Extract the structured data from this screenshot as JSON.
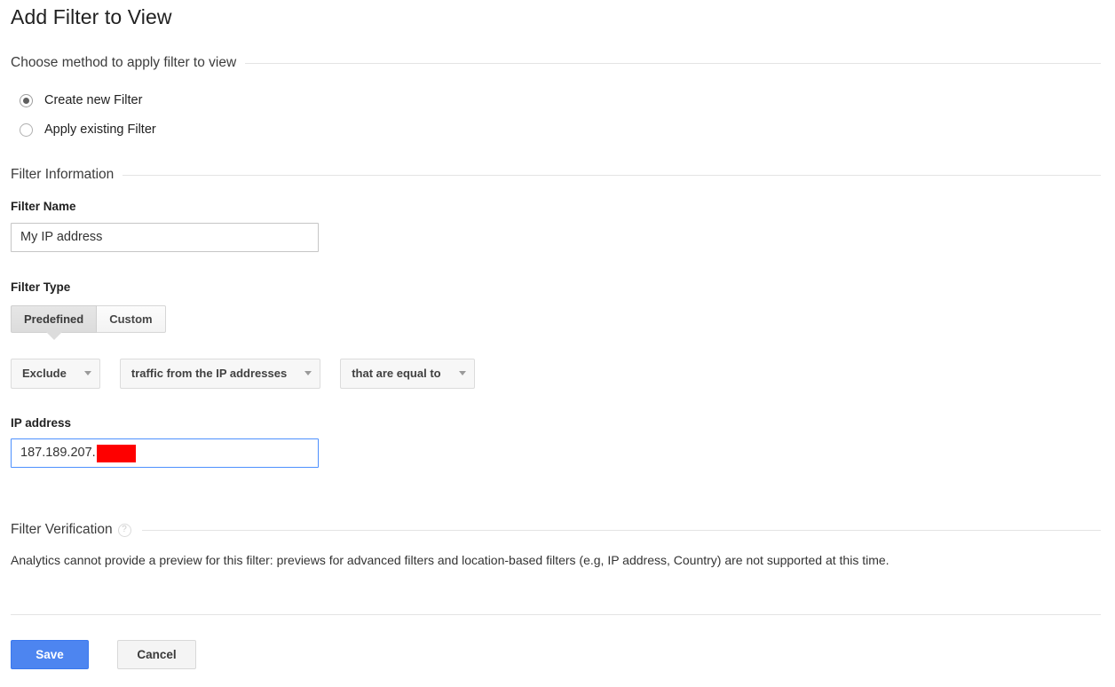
{
  "page": {
    "title": "Add Filter to View"
  },
  "method_section": {
    "heading": "Choose method to apply filter to view",
    "options": [
      {
        "label": "Create new Filter",
        "selected": true
      },
      {
        "label": "Apply existing Filter",
        "selected": false
      }
    ]
  },
  "filter_information": {
    "heading": "Filter Information",
    "filter_name": {
      "label": "Filter Name",
      "value": "My IP address",
      "placeholder": ""
    },
    "filter_type": {
      "label": "Filter Type",
      "tabs": [
        {
          "label": "Predefined",
          "selected": true
        },
        {
          "label": "Custom",
          "selected": false
        }
      ]
    },
    "dropdowns": [
      {
        "name": "filter-verb",
        "value": "Exclude"
      },
      {
        "name": "filter-source",
        "value": "traffic from the IP addresses"
      },
      {
        "name": "filter-match",
        "value": "that are equal to"
      }
    ],
    "ip_address": {
      "label": "IP address",
      "value": "187.189.207.",
      "redacted": true,
      "focused": true,
      "redaction_color": "#fe0000"
    }
  },
  "filter_verification": {
    "heading": "Filter Verification",
    "help_icon": "help-circle-icon",
    "message": "Analytics cannot provide a preview for this filter: previews for advanced filters and location-based filters (e.g, IP address, Country) are not supported at this time."
  },
  "actions": {
    "save_label": "Save",
    "cancel_label": "Cancel",
    "save_color": "#4d85f0"
  }
}
